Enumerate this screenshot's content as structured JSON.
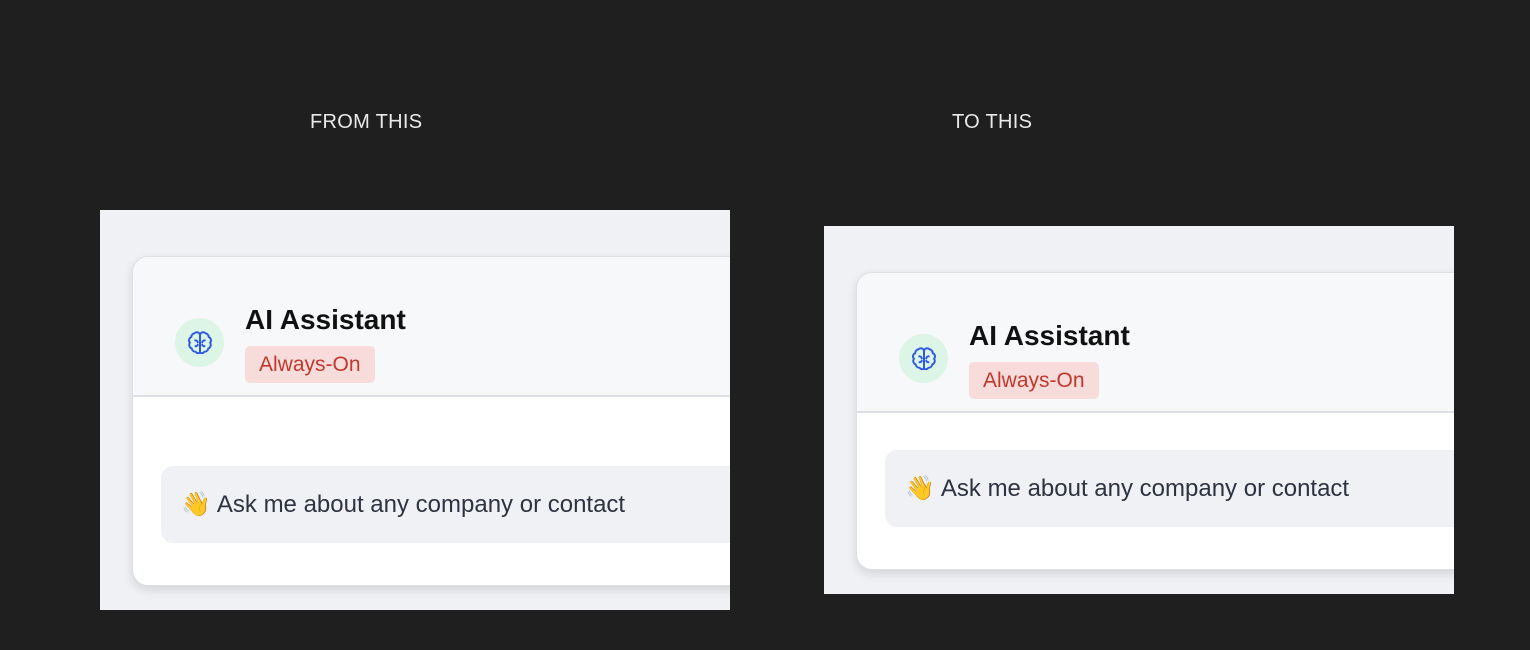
{
  "captions": {
    "from": "FROM THIS",
    "to": "TO THIS"
  },
  "widget": {
    "title": "AI Assistant",
    "badge": "Always-On",
    "avatar_icon": "brain-icon",
    "greeting_emoji": "👋",
    "greeting_text": "Ask me about any company or contact"
  },
  "colors": {
    "page_background": "#1f1f1f",
    "panel_background": "#eff1f5",
    "card_header_background": "#f7f8fa",
    "avatar_background": "#dcf5e6",
    "icon_color": "#2f5be0",
    "badge_background": "#f8dcdc",
    "badge_text": "#c0392b"
  }
}
